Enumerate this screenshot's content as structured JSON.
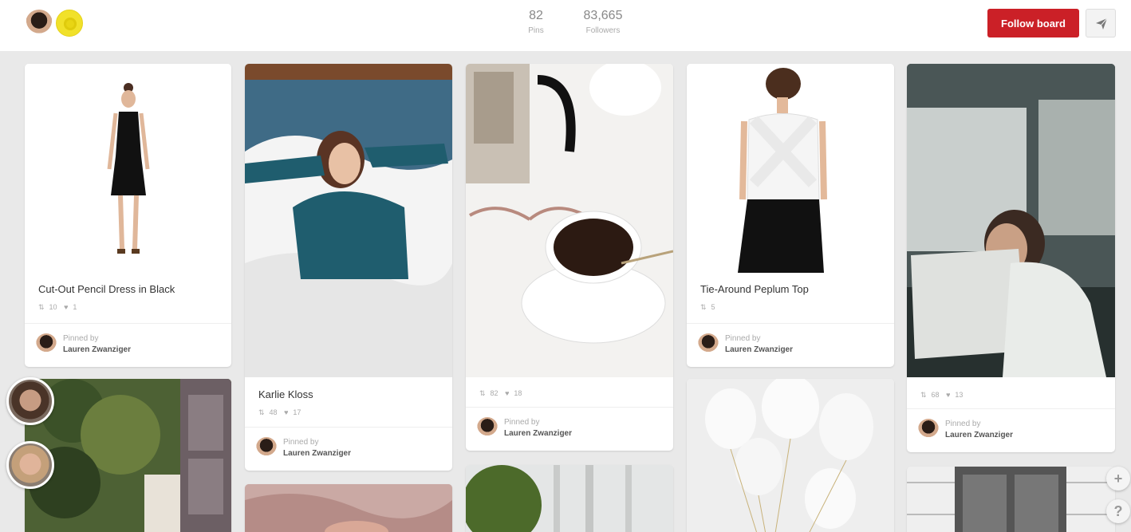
{
  "header": {
    "pins_count": "82",
    "pins_label": "Pins",
    "followers_count": "83,665",
    "followers_label": "Followers",
    "follow_button": "Follow board",
    "send_icon": "paper-plane-icon"
  },
  "colors": {
    "follow_button": "#cb2027",
    "background": "#e9e9e9"
  },
  "pins": [
    {
      "title": "Cut-Out Pencil Dress in Black",
      "repins": "10",
      "likes": "1",
      "pinned_by": "Pinned by",
      "pinner": "Lauren Zwanziger"
    },
    {
      "title": "Karlie Kloss",
      "repins": "48",
      "likes": "17",
      "pinned_by": "Pinned by",
      "pinner": "Lauren Zwanziger"
    },
    {
      "title": "",
      "repins": "82",
      "likes": "18",
      "pinned_by": "Pinned by",
      "pinner": "Lauren Zwanziger"
    },
    {
      "title": "Tie-Around Peplum Top",
      "repins": "5",
      "pinned_by": "Pinned by",
      "pinner": "Lauren Zwanziger"
    },
    {
      "title": "",
      "repins": "68",
      "likes": "13",
      "pinned_by": "Pinned by",
      "pinner": "Lauren Zwanziger"
    }
  ],
  "fab": {
    "add": "+",
    "help": "?"
  }
}
